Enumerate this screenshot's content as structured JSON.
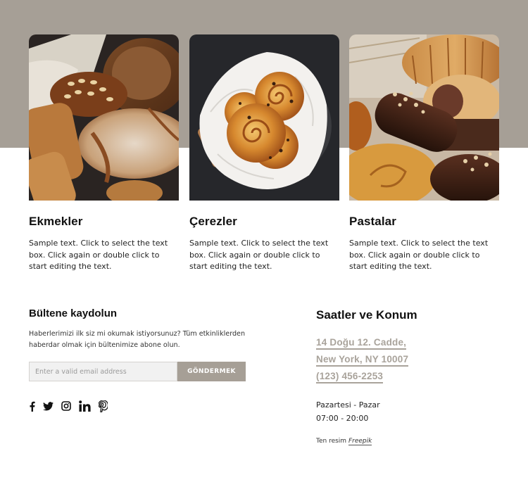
{
  "colors": {
    "band": "#a69f96",
    "link": "#a9a39b",
    "button": "#a69f96"
  },
  "cards": [
    {
      "image_alt": "Assorted breads with seeds and a rustic loaf",
      "title": "Ekmekler",
      "text": "Sample text. Click to select the text box. Click again or double click to start editing the text."
    },
    {
      "image_alt": "Chocolate chip swirl buns in a basket with paper",
      "title": "Çerezler",
      "text": "Sample text. Click to select the text box. Click again or double click to start editing the text."
    },
    {
      "image_alt": "Croissants and chocolate eclairs with nuts",
      "title": "Pastalar",
      "text": "Sample text. Click to select the text box. Click again or double click to start editing the text."
    }
  ],
  "newsletter": {
    "title": "Bültene kaydolun",
    "text": "Haberlerimizi ilk siz mi okumak istiyorsunuz? Tüm etkinliklerden haberdar olmak için bültenimize abone olun.",
    "email_placeholder": "Enter a valid email address",
    "email_value": "",
    "submit_label": "GÖNDERMEK"
  },
  "social": [
    {
      "name": "facebook",
      "icon": "facebook-icon"
    },
    {
      "name": "twitter",
      "icon": "twitter-icon"
    },
    {
      "name": "instagram",
      "icon": "instagram-icon"
    },
    {
      "name": "linkedin",
      "icon": "linkedin-icon"
    },
    {
      "name": "pinterest",
      "icon": "pinterest-icon"
    }
  ],
  "info": {
    "title": "Saatler ve Konum",
    "address_line1": "14 Doğu 12. Cadde,",
    "address_line2": "New York, NY 10007",
    "phone": "(123) 456-2253",
    "days": "Pazartesi - Pazar",
    "hours": "07:00 - 20:00",
    "credit_prefix": "Ten resim",
    "credit_link": "Freepik"
  }
}
